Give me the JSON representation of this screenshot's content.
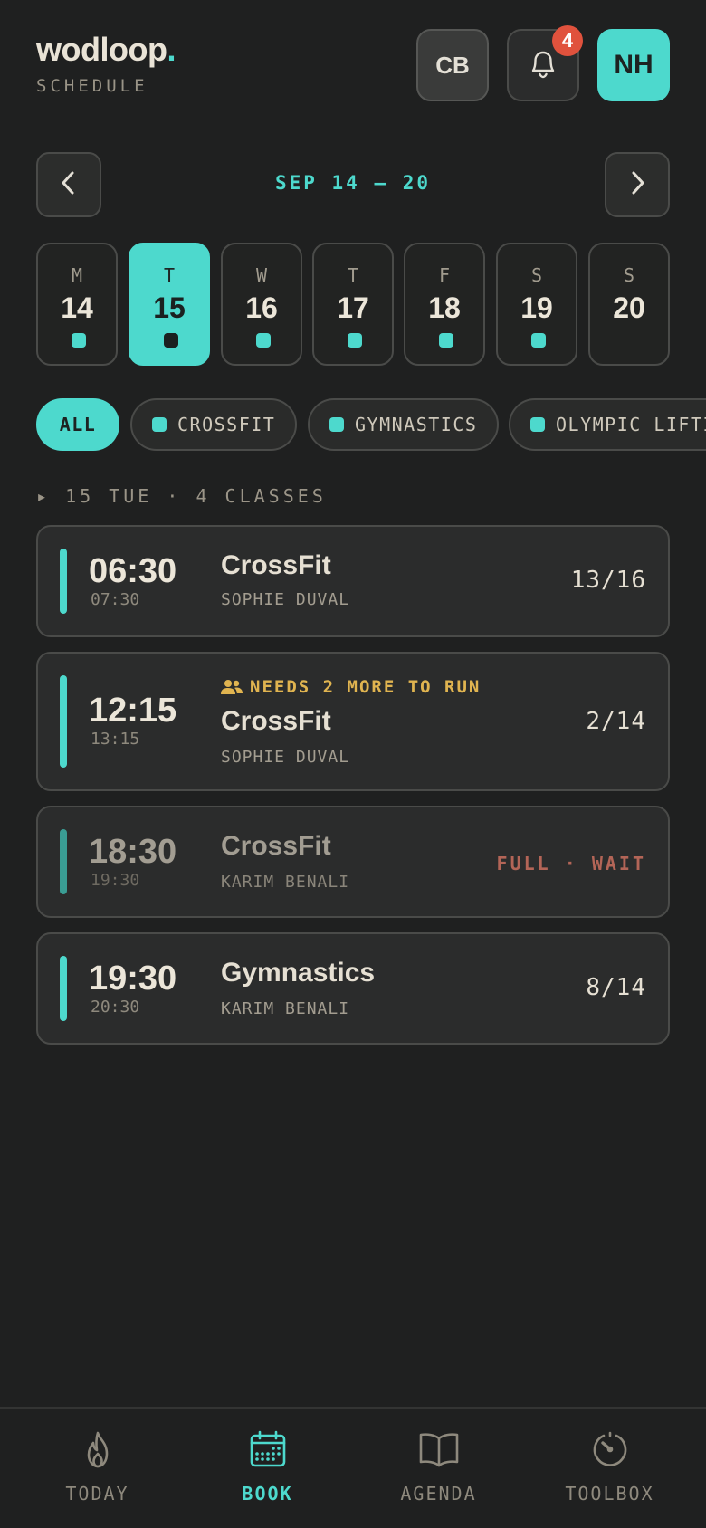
{
  "brand": {
    "name": "wodloop",
    "dot": ".",
    "subtitle": "SCHEDULE"
  },
  "header": {
    "box_initials": "CB",
    "notifications_count": "4",
    "avatar_initials": "NH"
  },
  "week": {
    "range": "SEP 14 – 20"
  },
  "days": [
    {
      "letter": "M",
      "num": "14",
      "has_classes": true
    },
    {
      "letter": "T",
      "num": "15",
      "has_classes": true,
      "selected": true
    },
    {
      "letter": "W",
      "num": "16",
      "has_classes": true
    },
    {
      "letter": "T",
      "num": "17",
      "has_classes": true
    },
    {
      "letter": "F",
      "num": "18",
      "has_classes": true
    },
    {
      "letter": "S",
      "num": "19",
      "has_classes": true
    },
    {
      "letter": "S",
      "num": "20",
      "has_classes": false
    }
  ],
  "filters": [
    {
      "label": "ALL",
      "active": true
    },
    {
      "label": "CROSSFIT"
    },
    {
      "label": "GYMNASTICS"
    },
    {
      "label": "OLYMPIC LIFTING"
    }
  ],
  "day_heading": "▸ 15 TUE · 4 CLASSES",
  "classes": [
    {
      "start": "06:30",
      "end": "07:30",
      "name": "CrossFit",
      "coach": "SOPHIE DUVAL",
      "capacity": "13/16"
    },
    {
      "start": "12:15",
      "end": "13:15",
      "name": "CrossFit",
      "coach": "SOPHIE DUVAL",
      "capacity": "2/14",
      "warning": "NEEDS 2 MORE TO RUN"
    },
    {
      "start": "18:30",
      "end": "19:30",
      "name": "CrossFit",
      "coach": "KARIM BENALI",
      "status": "FULL · WAIT"
    },
    {
      "start": "19:30",
      "end": "20:30",
      "name": "Gymnastics",
      "coach": "KARIM BENALI",
      "capacity": "8/14"
    }
  ],
  "tabs": [
    {
      "label": "TODAY",
      "icon": "flame-icon"
    },
    {
      "label": "BOOK",
      "icon": "calendar-icon",
      "active": true
    },
    {
      "label": "AGENDA",
      "icon": "book-icon"
    },
    {
      "label": "TOOLBOX",
      "icon": "timer-icon"
    }
  ],
  "colors": {
    "accent": "#4dd9cd",
    "badge": "#e0523d",
    "warning": "#e0b450",
    "full": "#b36557",
    "background": "#1f2020"
  }
}
